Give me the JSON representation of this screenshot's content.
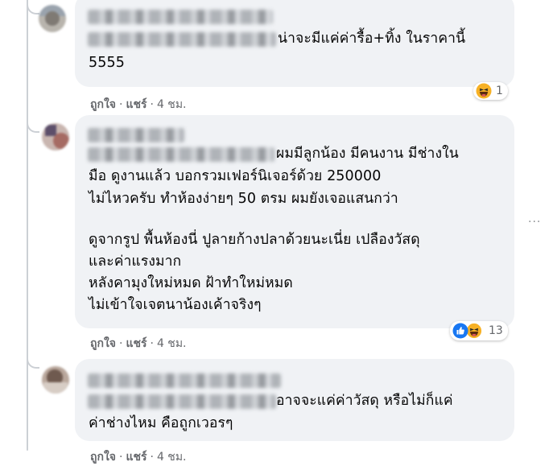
{
  "comments": [
    {
      "text_lines": [
        "น่าจะมีแค่ค่ารื้อ+ทิ้ง ในราคานี้",
        "5555"
      ],
      "reaction_icons": [
        "haha-icon"
      ],
      "reaction_count": "1",
      "like_label": "ถูกใจ",
      "share_label": "แชร์",
      "separator": "·",
      "time": "4 ชม."
    },
    {
      "text_lines": [
        "ผมมีลูกน้อง มีคนงาน มีช่างใน",
        "มือ ดูงานแล้ว บอกรวมเฟอร์นิเจอร์ด้วย 250000",
        "ไม่ไหวครับ ทำห้องง่ายๆ 50 ตรม ผมยังเจอแสนกว่า",
        "",
        "ดูจากรูป พื้นห้องนี่ ปูลายก้างปลาด้วยนะเนี่ย เปลืองวัสดุ",
        "และค่าแรงมาก",
        "หลังคามุงใหม่หมด ฝ้าทำใหม่หมด",
        "ไม่เข้าใจเจตนาน้องเค้าจริงๆ"
      ],
      "reaction_icons": [
        "like-icon",
        "haha-icon"
      ],
      "reaction_count": "13",
      "like_label": "ถูกใจ",
      "share_label": "แชร์",
      "separator": "·",
      "time": "4 ชม."
    },
    {
      "text_lines": [
        "อาจจะแค่ค่าวัสดุ หรือไม่ก็แค่",
        "ค่าช่างไหม คือถูกเวอรๆ"
      ],
      "like_label": "ถูกใจ",
      "share_label": "แชร์",
      "separator": "·",
      "time": "4 ชม."
    }
  ],
  "more_options_glyph": "···",
  "colors": {
    "bubble": "#f0f2f5",
    "meta_text": "#65676b",
    "thread_line": "#ccd0d5",
    "like_blue": "#1877f2",
    "haha_yellow": "#f7b125"
  }
}
